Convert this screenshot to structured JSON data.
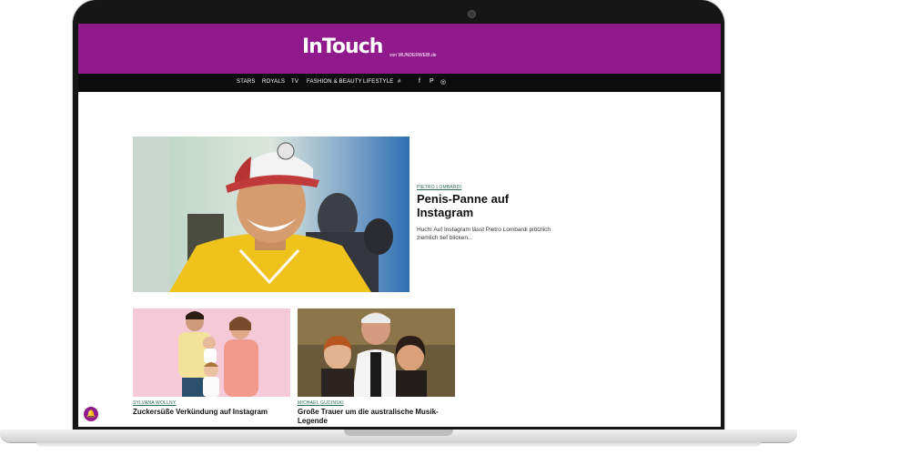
{
  "site": {
    "logo": "InTouch",
    "logo_sub": "von WUNDERWEIB.de",
    "brand_color": "#901a8c",
    "nav_background": "#0c0c0c",
    "tag_color": "#2a6e52"
  },
  "nav": {
    "items": [
      "STARS",
      "ROYALS",
      "TV",
      "FASHION & BEAUTY",
      "LIFESTYLE",
      "#"
    ],
    "social_icons": [
      "facebook-icon",
      "pinterest-icon",
      "instagram-icon"
    ],
    "social_glyphs": [
      "f",
      "P",
      "◎"
    ]
  },
  "hero": {
    "tag": "PIETRO LOMBARDI",
    "title": "Penis-Panne auf Instagram",
    "teaser": "Huch! Auf Instagram lässt Pietro Lombardi plötzlich ziemlich tief blicken..."
  },
  "cards": [
    {
      "tag": "SYLVANA WOLLNY",
      "title": "Zuckersüße Verkündung auf Instagram"
    },
    {
      "tag": "MICHAEL GUDINSKI",
      "title": "Große Trauer um die australische Musik-Legende"
    }
  ],
  "notification": {
    "icon": "bell-icon",
    "glyph": "🔔"
  }
}
